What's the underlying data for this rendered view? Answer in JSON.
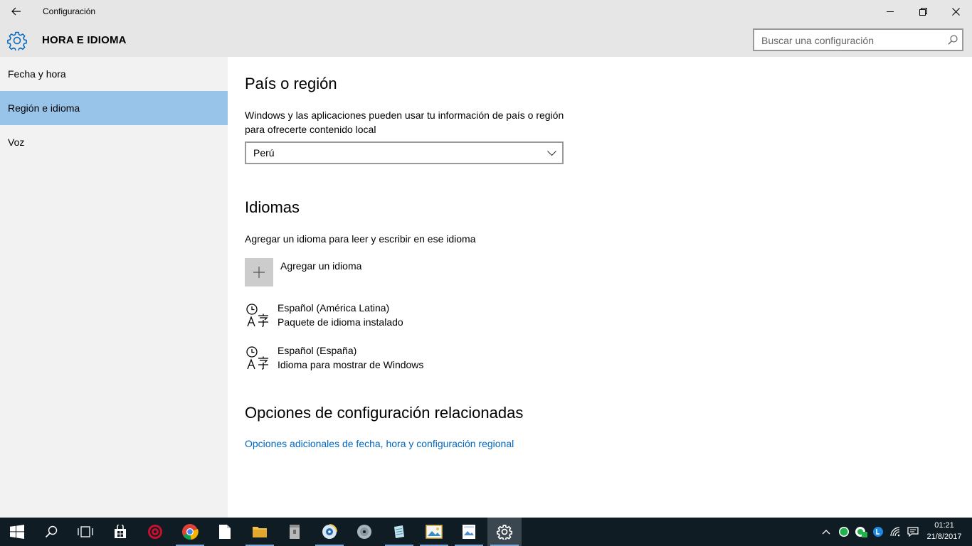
{
  "window": {
    "title": "Configuración"
  },
  "header": {
    "title": "HORA E IDIOMA",
    "search_placeholder": "Buscar una configuración"
  },
  "sidebar": {
    "items": [
      {
        "label": "Fecha y hora",
        "active": false
      },
      {
        "label": "Región e idioma",
        "active": true
      },
      {
        "label": "Voz",
        "active": false
      }
    ]
  },
  "main": {
    "region_heading": "País o región",
    "region_desc": "Windows y las aplicaciones pueden usar tu información de país o región para ofrecerte contenido local",
    "region_value": "Perú",
    "languages_heading": "Idiomas",
    "languages_desc": "Agregar un idioma para leer y escribir en ese idioma",
    "add_language_label": "Agregar un idioma",
    "languages": [
      {
        "name": "Español (América Latina)",
        "status": "Paquete de idioma instalado"
      },
      {
        "name": "Español (España)",
        "status": "Idioma para mostrar de Windows"
      }
    ],
    "related_heading": "Opciones de configuración relacionadas",
    "related_link": "Opciones adicionales de fecha, hora y configuración regional"
  },
  "taskbar": {
    "time": "01:21",
    "date": "21/8/2017"
  },
  "colors": {
    "accent": "#0067c0",
    "active_nav": "#99c4ea",
    "taskbar": "#101c24"
  }
}
